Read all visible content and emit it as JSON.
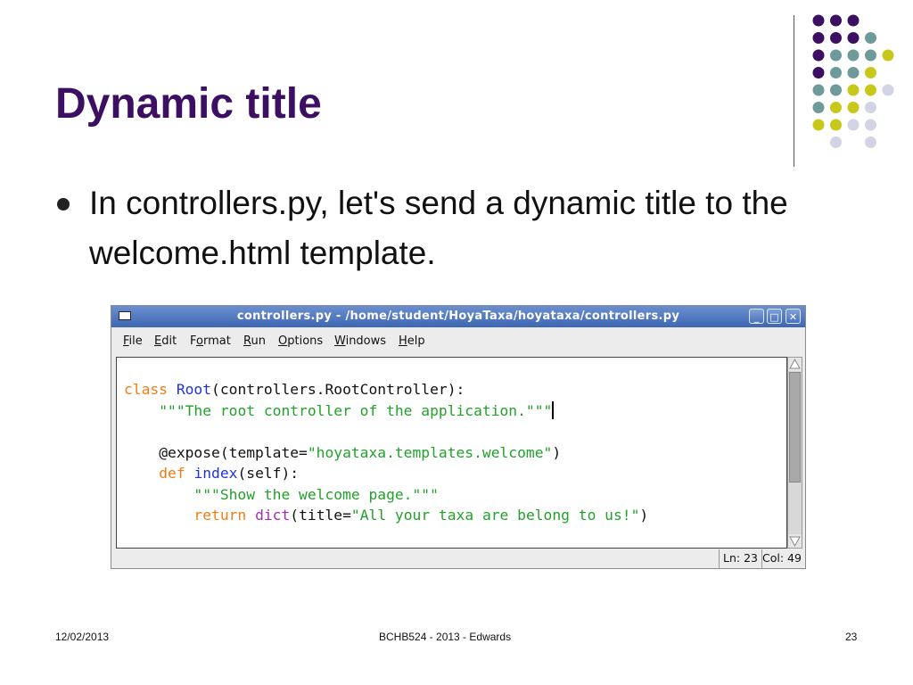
{
  "slide": {
    "title": "Dynamic title",
    "bullet": "In controllers.py, let's send a dynamic title to the welcome.html template."
  },
  "window": {
    "title": "controllers.py - /home/student/HoyaTaxa/hoyataxa/controllers.py",
    "buttons": {
      "minimize": "_",
      "maximize": "□",
      "close": "✕"
    },
    "menu": [
      {
        "mnemonic": "F",
        "rest": "ile"
      },
      {
        "mnemonic": "E",
        "rest": "dit"
      },
      {
        "pre": "F",
        "mnemonic": "o",
        "rest": "rmat"
      },
      {
        "mnemonic": "R",
        "rest": "un"
      },
      {
        "mnemonic": "O",
        "rest": "ptions"
      },
      {
        "mnemonic": "W",
        "rest": "indows"
      },
      {
        "mnemonic": "H",
        "rest": "elp"
      }
    ],
    "code": {
      "l1_kw": "class",
      "l1_name": "Root",
      "l1_rest": "(controllers.RootController):",
      "l2_str": "\"\"\"The root controller of the application.\"\"\"",
      "l4_pre": "@expose(template=",
      "l4_str": "\"hoyataxa.templates.welcome\"",
      "l4_post": ")",
      "l5_kw": "def",
      "l5_name": "index",
      "l5_rest": "(self):",
      "l6_str": "\"\"\"Show the welcome page.\"\"\"",
      "l7_kw": "return",
      "l7_bi": "dict",
      "l7_mid": "(title=",
      "l7_str": "\"All your taxa are belong to us!\"",
      "l7_post": ")"
    },
    "status": {
      "ln": "Ln: 23",
      "col": "Col: 49"
    }
  },
  "footer": {
    "date": "12/02/2013",
    "course": "BCHB524 - 2013 - Edwards",
    "page": "23"
  },
  "colors": {
    "purple": "#3d0f63",
    "teal": "#6f9a9a",
    "yellow": "#c8c81a",
    "lavender": "#d3d3e6"
  },
  "decoration": {
    "dot_grid": [
      [
        "purple",
        "purple",
        "purple",
        ""
      ],
      [
        "purple",
        "purple",
        "purple",
        "teal"
      ],
      [
        "purple",
        "teal",
        "teal",
        "teal",
        "yellow"
      ],
      [
        "purple",
        "teal",
        "teal",
        "yellow"
      ],
      [
        "teal",
        "teal",
        "yellow",
        "yellow",
        "lavender"
      ],
      [
        "teal",
        "yellow",
        "yellow",
        "lavender"
      ],
      [
        "yellow",
        "yellow",
        "lavender",
        "lavender"
      ],
      [
        "",
        "lavender",
        "",
        "lavender"
      ]
    ]
  }
}
